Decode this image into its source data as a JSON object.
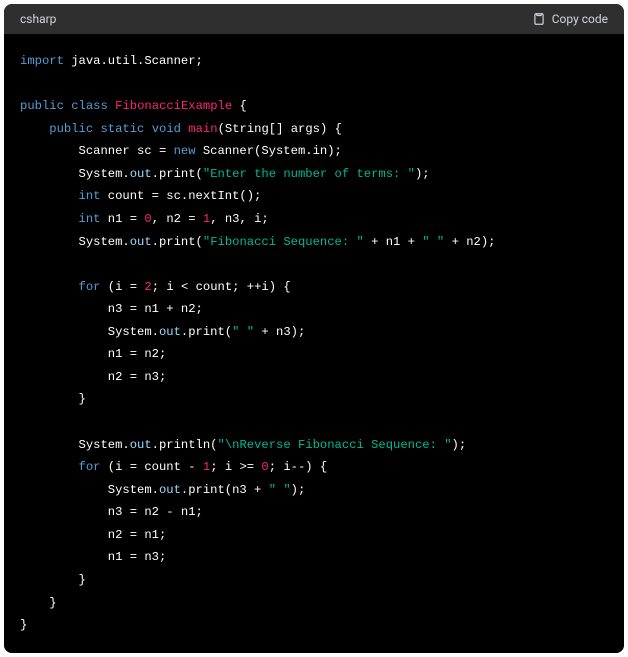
{
  "header": {
    "language": "csharp",
    "copy_label": "Copy code"
  },
  "code": {
    "l1_import": "import",
    "l1_rest": " java.util.Scanner;",
    "l3_public": "public",
    "l3_class": "class",
    "l3_name": "FibonacciExample",
    "l3_brace": " {",
    "l4_public": "public",
    "l4_static": "static",
    "l4_void": "void",
    "l4_main": "main",
    "l4_args": "(String[] args) {",
    "l5_a": "Scanner sc = ",
    "l5_new": "new",
    "l5_b": " Scanner(System.in);",
    "l6_sys": "System.",
    "l6_out": "out",
    "l6_print": ".print(",
    "l6_str": "\"Enter the number of terms: \"",
    "l6_end": ");",
    "l7_int": "int",
    "l7_rest": " count = sc.nextInt();",
    "l8_int": "int",
    "l8_a": " n1 = ",
    "l8_0": "0",
    "l8_b": ", n2 = ",
    "l8_1": "1",
    "l8_c": ", n3, i;",
    "l9_sys": "System.",
    "l9_out": "out",
    "l9_print": ".print(",
    "l9_str": "\"Fibonacci Sequence: \"",
    "l9_mid": " + n1 + ",
    "l9_str2": "\" \"",
    "l9_end": " + n2);",
    "l11_for": "for",
    "l11_a": " (i = ",
    "l11_2": "2",
    "l11_b": "; i < count; ++i) {",
    "l12": "n3 = n1 + n2;",
    "l13_sys": "System.",
    "l13_out": "out",
    "l13_print": ".print(",
    "l13_str": "\" \"",
    "l13_end": " + n3);",
    "l14": "n1 = n2;",
    "l15": "n2 = n3;",
    "l16": "}",
    "l18_sys": "System.",
    "l18_out": "out",
    "l18_println": ".println(",
    "l18_str": "\"\\nReverse Fibonacci Sequence: \"",
    "l18_end": ");",
    "l19_for": "for",
    "l19_a": " (i = count - ",
    "l19_1": "1",
    "l19_b": "; i >= ",
    "l19_0": "0",
    "l19_c": "; i--) {",
    "l20_sys": "System.",
    "l20_out": "out",
    "l20_print": ".print(n3 + ",
    "l20_str": "\" \"",
    "l20_end": ");",
    "l21": "n3 = n2 - n1;",
    "l22": "n2 = n1;",
    "l23": "n1 = n3;",
    "l24": "}",
    "l25": "}",
    "l26": "}"
  }
}
